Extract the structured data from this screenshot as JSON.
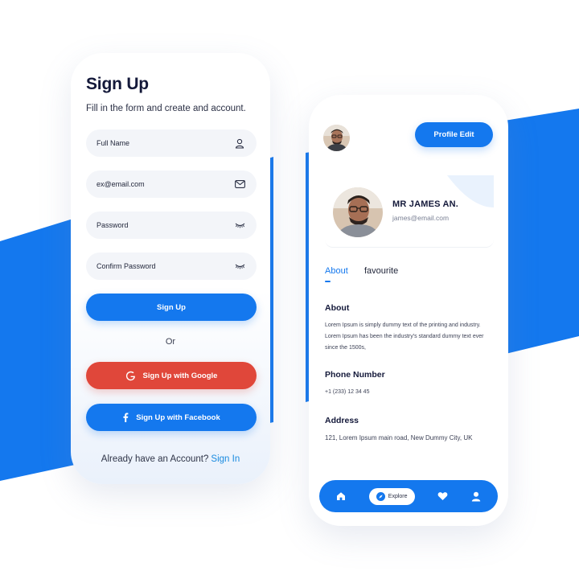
{
  "colors": {
    "accent": "#1478ee",
    "google": "#e0473a",
    "title": "#14193a",
    "link": "#1a8be0"
  },
  "signup": {
    "title": "Sign Up",
    "subtitle": "Fill in the form and create and account.",
    "fields": {
      "full_name": {
        "placeholder": "Full Name",
        "icon": "user-icon"
      },
      "email": {
        "placeholder": "ex@email.com",
        "icon": "mail-icon"
      },
      "password": {
        "placeholder": "Password",
        "icon": "eye-closed-icon"
      },
      "confirm_password": {
        "placeholder": "Confirm Password",
        "icon": "eye-closed-icon"
      }
    },
    "signup_button": "Sign Up",
    "or_label": "Or",
    "google_button": "Sign Up with Google",
    "facebook_button": "Sign Up with Facebook",
    "already_text": "Already have an Account?",
    "signin_link": "Sign In"
  },
  "profile": {
    "edit_button": "Profile Edit",
    "name": "MR JAMES AN.",
    "email": "james@email.com",
    "tabs": [
      "About",
      "favourite"
    ],
    "active_tab": "About",
    "sections": {
      "about": {
        "heading": "About",
        "text": "Lorem Ipsum is simply dummy text of the printing and industry. Lorem Ipsum has been the industry's standard dummy text ever since the 1500s,"
      },
      "phone": {
        "heading": "Phone Number",
        "text": "+1 (233) 12 34 45"
      },
      "address": {
        "heading": "Address",
        "text": "121, Lorem Ipsum main road, New Dummy City, UK"
      }
    },
    "nav": {
      "items": [
        "home-icon",
        "compass-icon",
        "heart-icon",
        "person-icon"
      ],
      "explore_label": "Explore"
    }
  }
}
